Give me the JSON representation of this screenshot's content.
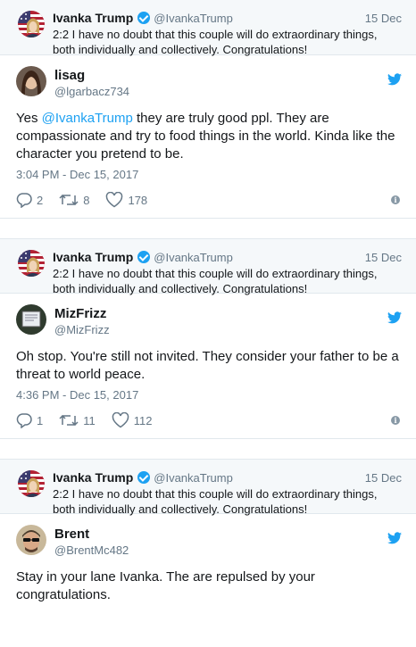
{
  "cards": [
    {
      "quote": {
        "name": "Ivanka Trump",
        "handle": "@IvankaTrump",
        "date": "15 Dec",
        "text": "2:2 I have no doubt that this couple will do extraordinary things, both individually and collectively. Congratulations!"
      },
      "tweet": {
        "name": "lisag",
        "handle": "@lgarbacz734",
        "mention": "@IvankaTrump",
        "text_before": "Yes ",
        "text_after": " they are truly good ppl. They are compassionate and try to food things in the world. Kinda like the character you pretend to be.",
        "time": "3:04 PM - Dec 15, 2017",
        "replies": "2",
        "retweets": "8",
        "likes": "178"
      }
    },
    {
      "quote": {
        "name": "Ivanka Trump",
        "handle": "@IvankaTrump",
        "date": "15 Dec",
        "text": "2:2 I have no doubt that this couple will do extraordinary things, both individually and collectively. Congratulations!"
      },
      "tweet": {
        "name": "MizFrizz",
        "handle": "@MizFrizz",
        "text": "Oh stop. You're still not invited. They consider your father to be a threat to world peace.",
        "time": "4:36 PM - Dec 15, 2017",
        "replies": "1",
        "retweets": "11",
        "likes": "112"
      }
    },
    {
      "quote": {
        "name": "Ivanka Trump",
        "handle": "@IvankaTrump",
        "date": "15 Dec",
        "text": "2:2 I have no doubt that this couple will do extraordinary things, both individually and collectively. Congratulations!"
      },
      "tweet": {
        "name": "Brent",
        "handle": "@BrentMc482",
        "text": "Stay in your lane Ivanka. The are repulsed by your congratulations."
      }
    }
  ],
  "icons": {
    "reply": "reply-icon",
    "retweet": "retweet-icon",
    "like": "heart-icon",
    "info": "info-icon",
    "bird": "twitter-bird-icon"
  },
  "colors": {
    "accent": "#1da1f2",
    "muted": "#657786",
    "quote_bg": "#f5f8fa"
  }
}
